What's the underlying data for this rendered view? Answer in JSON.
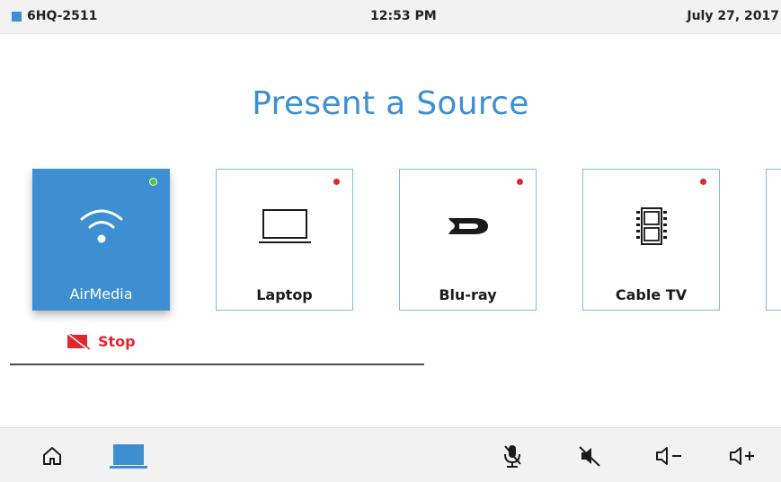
{
  "status_bar": {
    "room_name": "6HQ-2511",
    "time": "12:53 PM",
    "date": "July 27, 2017"
  },
  "page_title": "Present a Source",
  "sources": [
    {
      "label": "AirMedia",
      "icon": "wifi-icon",
      "active": true,
      "status_color": "#4ccc3c"
    },
    {
      "label": "Laptop",
      "icon": "laptop-icon",
      "active": false,
      "status_color": "#e3262b"
    },
    {
      "label": "Blu-ray",
      "icon": "bluray-icon",
      "active": false,
      "status_color": "#e3262b"
    },
    {
      "label": "Cable TV",
      "icon": "film-icon",
      "active": false,
      "status_color": "#e3262b"
    }
  ],
  "stop_label": "Stop",
  "toolbar": {
    "buttons": [
      "home-icon",
      "display-icon",
      "mic-mute-icon",
      "speaker-mute-icon",
      "volume-down-icon",
      "volume-up-icon"
    ]
  },
  "colors": {
    "accent": "#3d8fd1",
    "status_off": "#e3262b",
    "status_on": "#4ccc3c"
  }
}
